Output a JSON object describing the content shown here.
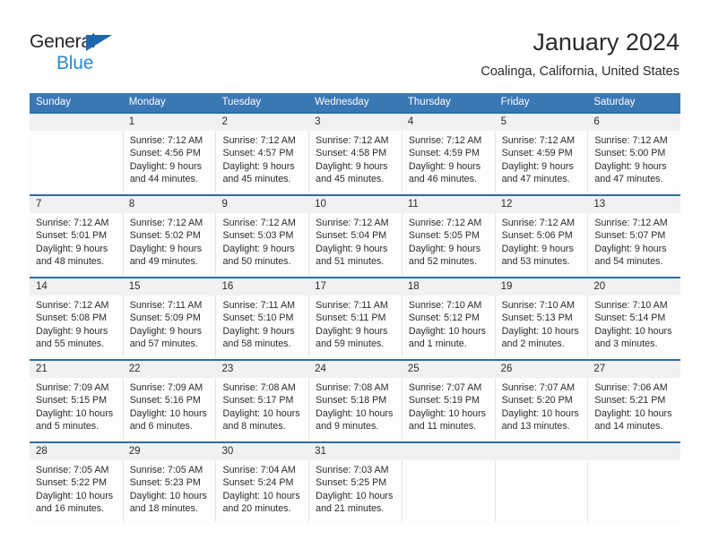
{
  "brand": {
    "name_part1": "General",
    "name_part2": "Blue"
  },
  "header": {
    "title": "January 2024",
    "location": "Coalinga, California, United States"
  },
  "colors": {
    "header_blue": "#3a77b5",
    "week_divider": "#2e6da4",
    "daynum_bg": "#f1f1f1",
    "logo_blue": "#2a8bd4",
    "logo_triangle": "#1b68b0"
  },
  "weekdays": [
    "Sunday",
    "Monday",
    "Tuesday",
    "Wednesday",
    "Thursday",
    "Friday",
    "Saturday"
  ],
  "weeks": [
    [
      {
        "day": "",
        "sunrise": "",
        "sunset": "",
        "daylight1": "",
        "daylight2": ""
      },
      {
        "day": "1",
        "sunrise": "Sunrise: 7:12 AM",
        "sunset": "Sunset: 4:56 PM",
        "daylight1": "Daylight: 9 hours",
        "daylight2": "and 44 minutes."
      },
      {
        "day": "2",
        "sunrise": "Sunrise: 7:12 AM",
        "sunset": "Sunset: 4:57 PM",
        "daylight1": "Daylight: 9 hours",
        "daylight2": "and 45 minutes."
      },
      {
        "day": "3",
        "sunrise": "Sunrise: 7:12 AM",
        "sunset": "Sunset: 4:58 PM",
        "daylight1": "Daylight: 9 hours",
        "daylight2": "and 45 minutes."
      },
      {
        "day": "4",
        "sunrise": "Sunrise: 7:12 AM",
        "sunset": "Sunset: 4:59 PM",
        "daylight1": "Daylight: 9 hours",
        "daylight2": "and 46 minutes."
      },
      {
        "day": "5",
        "sunrise": "Sunrise: 7:12 AM",
        "sunset": "Sunset: 4:59 PM",
        "daylight1": "Daylight: 9 hours",
        "daylight2": "and 47 minutes."
      },
      {
        "day": "6",
        "sunrise": "Sunrise: 7:12 AM",
        "sunset": "Sunset: 5:00 PM",
        "daylight1": "Daylight: 9 hours",
        "daylight2": "and 47 minutes."
      }
    ],
    [
      {
        "day": "7",
        "sunrise": "Sunrise: 7:12 AM",
        "sunset": "Sunset: 5:01 PM",
        "daylight1": "Daylight: 9 hours",
        "daylight2": "and 48 minutes."
      },
      {
        "day": "8",
        "sunrise": "Sunrise: 7:12 AM",
        "sunset": "Sunset: 5:02 PM",
        "daylight1": "Daylight: 9 hours",
        "daylight2": "and 49 minutes."
      },
      {
        "day": "9",
        "sunrise": "Sunrise: 7:12 AM",
        "sunset": "Sunset: 5:03 PM",
        "daylight1": "Daylight: 9 hours",
        "daylight2": "and 50 minutes."
      },
      {
        "day": "10",
        "sunrise": "Sunrise: 7:12 AM",
        "sunset": "Sunset: 5:04 PM",
        "daylight1": "Daylight: 9 hours",
        "daylight2": "and 51 minutes."
      },
      {
        "day": "11",
        "sunrise": "Sunrise: 7:12 AM",
        "sunset": "Sunset: 5:05 PM",
        "daylight1": "Daylight: 9 hours",
        "daylight2": "and 52 minutes."
      },
      {
        "day": "12",
        "sunrise": "Sunrise: 7:12 AM",
        "sunset": "Sunset: 5:06 PM",
        "daylight1": "Daylight: 9 hours",
        "daylight2": "and 53 minutes."
      },
      {
        "day": "13",
        "sunrise": "Sunrise: 7:12 AM",
        "sunset": "Sunset: 5:07 PM",
        "daylight1": "Daylight: 9 hours",
        "daylight2": "and 54 minutes."
      }
    ],
    [
      {
        "day": "14",
        "sunrise": "Sunrise: 7:12 AM",
        "sunset": "Sunset: 5:08 PM",
        "daylight1": "Daylight: 9 hours",
        "daylight2": "and 55 minutes."
      },
      {
        "day": "15",
        "sunrise": "Sunrise: 7:11 AM",
        "sunset": "Sunset: 5:09 PM",
        "daylight1": "Daylight: 9 hours",
        "daylight2": "and 57 minutes."
      },
      {
        "day": "16",
        "sunrise": "Sunrise: 7:11 AM",
        "sunset": "Sunset: 5:10 PM",
        "daylight1": "Daylight: 9 hours",
        "daylight2": "and 58 minutes."
      },
      {
        "day": "17",
        "sunrise": "Sunrise: 7:11 AM",
        "sunset": "Sunset: 5:11 PM",
        "daylight1": "Daylight: 9 hours",
        "daylight2": "and 59 minutes."
      },
      {
        "day": "18",
        "sunrise": "Sunrise: 7:10 AM",
        "sunset": "Sunset: 5:12 PM",
        "daylight1": "Daylight: 10 hours",
        "daylight2": "and 1 minute."
      },
      {
        "day": "19",
        "sunrise": "Sunrise: 7:10 AM",
        "sunset": "Sunset: 5:13 PM",
        "daylight1": "Daylight: 10 hours",
        "daylight2": "and 2 minutes."
      },
      {
        "day": "20",
        "sunrise": "Sunrise: 7:10 AM",
        "sunset": "Sunset: 5:14 PM",
        "daylight1": "Daylight: 10 hours",
        "daylight2": "and 3 minutes."
      }
    ],
    [
      {
        "day": "21",
        "sunrise": "Sunrise: 7:09 AM",
        "sunset": "Sunset: 5:15 PM",
        "daylight1": "Daylight: 10 hours",
        "daylight2": "and 5 minutes."
      },
      {
        "day": "22",
        "sunrise": "Sunrise: 7:09 AM",
        "sunset": "Sunset: 5:16 PM",
        "daylight1": "Daylight: 10 hours",
        "daylight2": "and 6 minutes."
      },
      {
        "day": "23",
        "sunrise": "Sunrise: 7:08 AM",
        "sunset": "Sunset: 5:17 PM",
        "daylight1": "Daylight: 10 hours",
        "daylight2": "and 8 minutes."
      },
      {
        "day": "24",
        "sunrise": "Sunrise: 7:08 AM",
        "sunset": "Sunset: 5:18 PM",
        "daylight1": "Daylight: 10 hours",
        "daylight2": "and 9 minutes."
      },
      {
        "day": "25",
        "sunrise": "Sunrise: 7:07 AM",
        "sunset": "Sunset: 5:19 PM",
        "daylight1": "Daylight: 10 hours",
        "daylight2": "and 11 minutes."
      },
      {
        "day": "26",
        "sunrise": "Sunrise: 7:07 AM",
        "sunset": "Sunset: 5:20 PM",
        "daylight1": "Daylight: 10 hours",
        "daylight2": "and 13 minutes."
      },
      {
        "day": "27",
        "sunrise": "Sunrise: 7:06 AM",
        "sunset": "Sunset: 5:21 PM",
        "daylight1": "Daylight: 10 hours",
        "daylight2": "and 14 minutes."
      }
    ],
    [
      {
        "day": "28",
        "sunrise": "Sunrise: 7:05 AM",
        "sunset": "Sunset: 5:22 PM",
        "daylight1": "Daylight: 10 hours",
        "daylight2": "and 16 minutes."
      },
      {
        "day": "29",
        "sunrise": "Sunrise: 7:05 AM",
        "sunset": "Sunset: 5:23 PM",
        "daylight1": "Daylight: 10 hours",
        "daylight2": "and 18 minutes."
      },
      {
        "day": "30",
        "sunrise": "Sunrise: 7:04 AM",
        "sunset": "Sunset: 5:24 PM",
        "daylight1": "Daylight: 10 hours",
        "daylight2": "and 20 minutes."
      },
      {
        "day": "31",
        "sunrise": "Sunrise: 7:03 AM",
        "sunset": "Sunset: 5:25 PM",
        "daylight1": "Daylight: 10 hours",
        "daylight2": "and 21 minutes."
      },
      {
        "day": "",
        "sunrise": "",
        "sunset": "",
        "daylight1": "",
        "daylight2": ""
      },
      {
        "day": "",
        "sunrise": "",
        "sunset": "",
        "daylight1": "",
        "daylight2": ""
      },
      {
        "day": "",
        "sunrise": "",
        "sunset": "",
        "daylight1": "",
        "daylight2": ""
      }
    ]
  ]
}
